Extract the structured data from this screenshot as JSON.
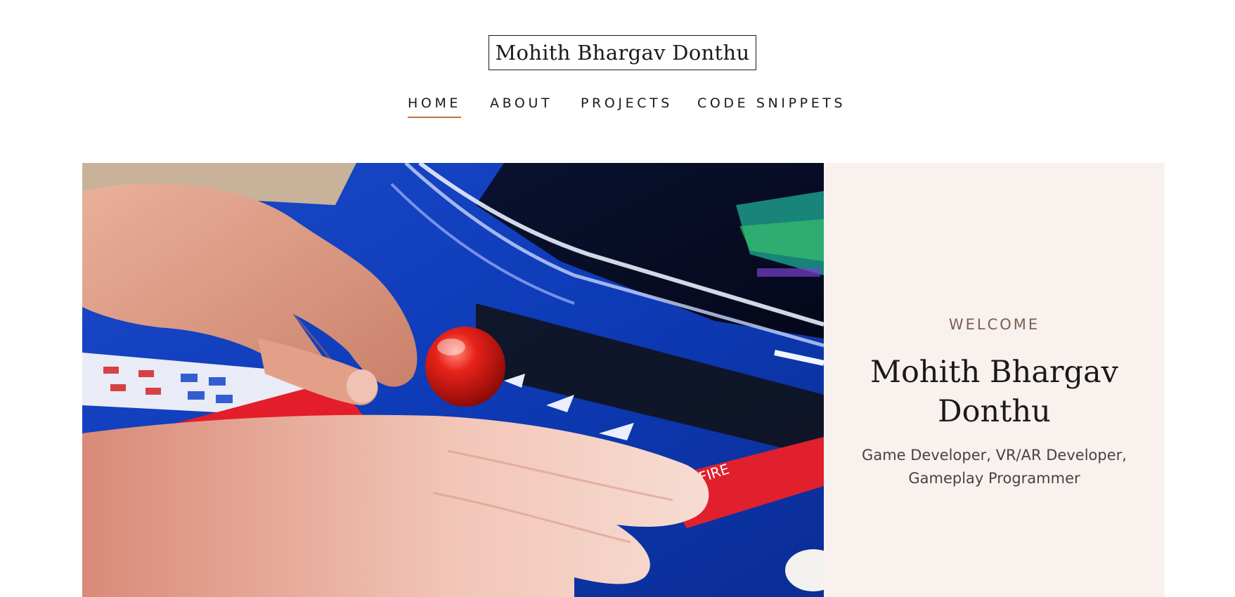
{
  "header": {
    "site_title": "Mohith Bhargav Donthu"
  },
  "nav": {
    "items": [
      {
        "label": "HOME",
        "active": true
      },
      {
        "label": "ABOUT",
        "active": false
      },
      {
        "label": "PROJECTS",
        "active": false
      },
      {
        "label": "CODE SNIPPETS",
        "active": false
      }
    ],
    "active_underline_color": "#c0703f"
  },
  "hero": {
    "image": {
      "description_icon": "arcade-joystick-photo",
      "cabinet_text": "FIRE"
    },
    "panel": {
      "welcome": "WELCOME",
      "name": "Mohith Bhargav Donthu",
      "subtitle": "Game Developer, VR/AR Developer, Gameplay Programmer",
      "background_color": "#f9f1ee",
      "welcome_color": "#7a5f52"
    }
  }
}
